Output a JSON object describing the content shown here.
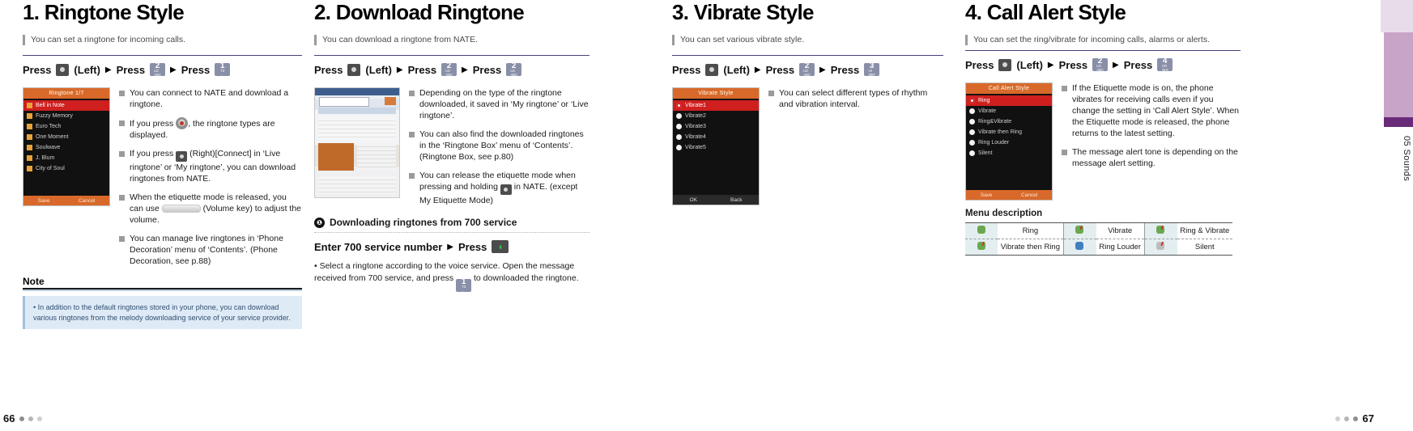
{
  "document": {
    "side_tab_label": "05 Sounds",
    "page_left": "66",
    "page_right": "67"
  },
  "sections": [
    {
      "title": "1. Ringtone Style",
      "subtitle": "You can set a ringtone for incoming calls.",
      "press_label": "Press",
      "press_left": "(Left)",
      "keys": [
        {
          "glyph": "●",
          "sub": "",
          "type": "dark"
        },
        {
          "glyph": "2",
          "sub": "LD\nABC",
          "type": "num"
        },
        {
          "glyph": "1",
          "sub": "73\n.,",
          "type": "num"
        }
      ],
      "phone": {
        "header": "Ringtone          1/7",
        "footer_left": "Save",
        "footer_right": "Cancel",
        "items": [
          "Bell in Note",
          "Fuzzy Memory",
          "Euro Tech",
          "One Moment",
          "Soulwave",
          "J. Blum",
          "City of Soul"
        ],
        "selected_index": 0
      },
      "bullets": [
        "You can connect to NATE and download a ringtone.",
        "If you press  , the ringtone types are displayed.",
        "If you press  (Right)[Connect] in ‘Live ringtone’ or ‘My ringtone’, you can download ringtones from NATE.",
        "When the etiquette mode is released, you can use  (Volume key) to adjust the volume.",
        "You can manage live ringtones in ‘Phone Decoration’ menu of ‘Contents’. (Phone Decoration, see p.88)"
      ],
      "note_heading": "Note",
      "note_text": "• In addition to the default ringtones stored in your phone, you can download various ringtones from the melody downloading service of your service provider."
    },
    {
      "title": "2. Download Ringtone",
      "subtitle": "You can download a ringtone from NATE.",
      "press_label": "Press",
      "press_left": "(Left)",
      "keys": [
        {
          "glyph": "●",
          "sub": "",
          "type": "dark"
        },
        {
          "glyph": "2",
          "sub": "LD\nABC",
          "type": "num"
        },
        {
          "glyph": "2",
          "sub": "LD\nABC",
          "type": "num"
        }
      ],
      "bullets": [
        "Depending on the type of the ringtone downloaded, it saved in ‘My ringtone’ or ‘Live ringtone’.",
        "You can also find the downloaded ringtones in the ‘Ringtone Box’ menu of ‘Contents’. (Ringtone Box, see p.80)",
        "You can release the etiquette mode when pressing and holding  in NATE. (except My Etiquette Mode)"
      ],
      "sub_section": {
        "number": "❶",
        "heading": "Downloading ringtones from 700 service",
        "press_line_label": "Enter 700 service number",
        "press_label": "Press",
        "key": {
          "glyph": "◔",
          "type": "green"
        },
        "bullet": "• Select a ringtone according to the voice service. Open the message received from 700 service, and press  to downloaded the ringtone."
      }
    },
    {
      "title": "3. Vibrate Style",
      "subtitle": "You can set various vibrate style.",
      "press_label": "Press",
      "press_left": "(Left)",
      "keys": [
        {
          "glyph": "●",
          "sub": "",
          "type": "dark"
        },
        {
          "glyph": "2",
          "sub": "LD\nABC",
          "type": "num"
        },
        {
          "glyph": "3",
          "sub": "HI\nDEF",
          "type": "num"
        }
      ],
      "phone": {
        "header": "Vibrate Style",
        "footer_left": "OK",
        "footer_right": "Back",
        "items": [
          "Vibrate1",
          "Vibrate2",
          "Vibrate3",
          "Vibrate4",
          "Vibrate5"
        ],
        "selected_index": 0
      },
      "bullets": [
        "You can select different types of rhythm and vibration interval."
      ]
    },
    {
      "title": "4. Call Alert Style",
      "subtitle": "You can set the ring/vibrate for incoming calls, alarms or alerts.",
      "press_label": "Press",
      "press_left": "(Left)",
      "keys": [
        {
          "glyph": "●",
          "sub": "",
          "type": "dark"
        },
        {
          "glyph": "2",
          "sub": "LD\nABC",
          "type": "num"
        },
        {
          "glyph": "4",
          "sub": "CR\nGHI",
          "type": "num"
        }
      ],
      "phone": {
        "header": "Call Alert Style",
        "footer_left": "Save",
        "footer_right": "Cancel",
        "items": [
          "Ring",
          "Vibrate",
          "Ring&Vibrate",
          "Vibrate then Ring",
          "Ring Louder",
          "Silent"
        ],
        "selected_index": 0
      },
      "bullets": [
        "If the Etiquette mode is on, the phone vibrates for receiving calls even if you change the setting in ‘Call Alert Style’. When the Etiquette mode is released, the phone returns to the latest setting.",
        "The message alert tone is depending on the message alert setting."
      ],
      "menu_description": {
        "title": "Menu description",
        "rows": [
          [
            {
              "icon": "ring-icon",
              "label": "Ring"
            },
            {
              "icon": "vibrate-icon",
              "label": "Vibrate"
            },
            {
              "icon": "ring-and-vibrate-icon",
              "label": "Ring & Vibrate"
            }
          ],
          [
            {
              "icon": "vibrate-then-ring-icon",
              "label": "Vibrate then Ring"
            },
            {
              "icon": "ring-louder-icon",
              "label": "Ring Louder"
            },
            {
              "icon": "silent-icon",
              "label": "Silent"
            }
          ]
        ]
      }
    }
  ]
}
